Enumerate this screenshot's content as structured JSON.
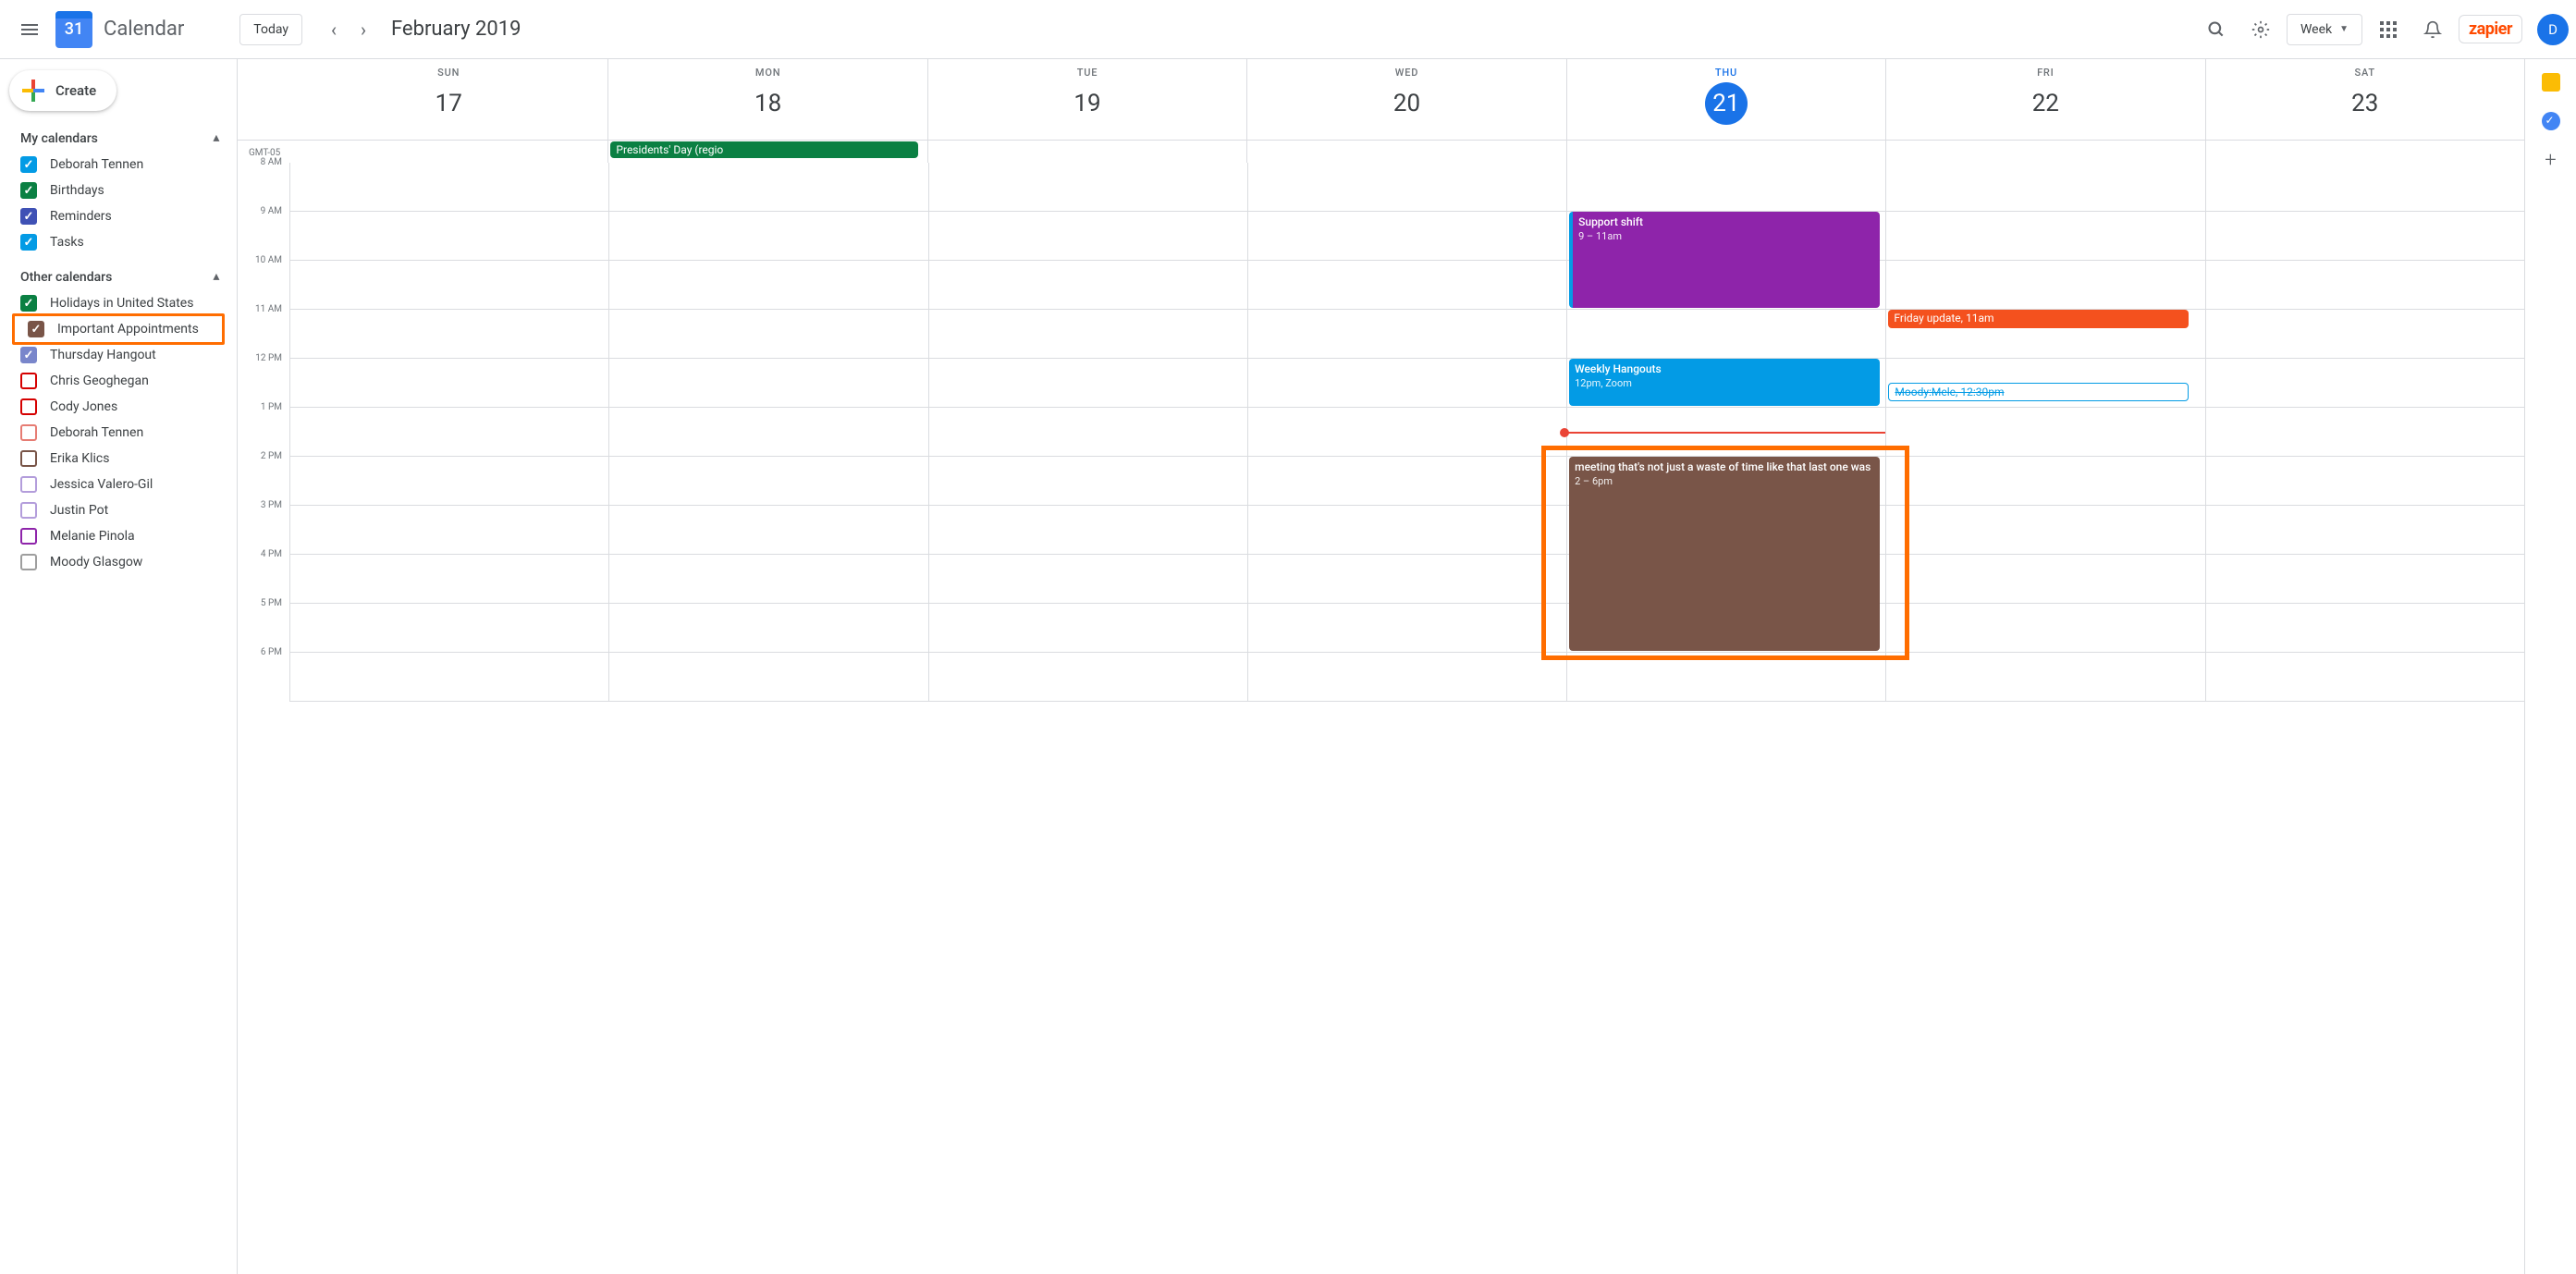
{
  "header": {
    "logo_day": "31",
    "app_name": "Calendar",
    "today_label": "Today",
    "month_title": "February 2019",
    "view_label": "Week",
    "avatar_letter": "D",
    "zapier_label": "zapier"
  },
  "sidebar": {
    "create_label": "Create",
    "my_calendars_title": "My calendars",
    "my_calendars": [
      {
        "label": "Deborah Tennen",
        "color": "#039be5",
        "checked": true
      },
      {
        "label": "Birthdays",
        "color": "#0b8043",
        "checked": true
      },
      {
        "label": "Reminders",
        "color": "#3f51b5",
        "checked": true
      },
      {
        "label": "Tasks",
        "color": "#039be5",
        "checked": true
      }
    ],
    "other_calendars_title": "Other calendars",
    "other_calendars": [
      {
        "label": "Holidays in United States",
        "color": "#0b8043",
        "checked": true,
        "highlighted": false
      },
      {
        "label": "Important Appointments",
        "color": "#795548",
        "checked": true,
        "highlighted": true
      },
      {
        "label": "Thursday Hangout",
        "color": "#7986cb",
        "checked": true,
        "highlighted": false
      },
      {
        "label": "Chris Geoghegan",
        "color": "#d50000",
        "checked": false,
        "highlighted": false
      },
      {
        "label": "Cody Jones",
        "color": "#d50000",
        "checked": false,
        "highlighted": false
      },
      {
        "label": "Deborah Tennen",
        "color": "#e67c73",
        "checked": false,
        "highlighted": false
      },
      {
        "label": "Erika Klics",
        "color": "#795548",
        "checked": false,
        "highlighted": false
      },
      {
        "label": "Jessica Valero-Gil",
        "color": "#b39ddb",
        "checked": false,
        "highlighted": false
      },
      {
        "label": "Justin Pot",
        "color": "#b39ddb",
        "checked": false,
        "highlighted": false
      },
      {
        "label": "Melanie Pinola",
        "color": "#8e24aa",
        "checked": false,
        "highlighted": false
      },
      {
        "label": "Moody Glasgow",
        "color": "#9e9e9e",
        "checked": false,
        "highlighted": false
      }
    ]
  },
  "calendar": {
    "timezone": "GMT-05",
    "days": [
      {
        "abbr": "SUN",
        "num": "17",
        "today": false
      },
      {
        "abbr": "MON",
        "num": "18",
        "today": false
      },
      {
        "abbr": "TUE",
        "num": "19",
        "today": false
      },
      {
        "abbr": "WED",
        "num": "20",
        "today": false
      },
      {
        "abbr": "THU",
        "num": "21",
        "today": true
      },
      {
        "abbr": "FRI",
        "num": "22",
        "today": false
      },
      {
        "abbr": "SAT",
        "num": "23",
        "today": false
      }
    ],
    "hours": [
      "8 AM",
      "9 AM",
      "10 AM",
      "11 AM",
      "12 PM",
      "1 PM",
      "2 PM",
      "3 PM",
      "4 PM",
      "5 PM",
      "6 PM"
    ],
    "allday_events": {
      "mon": {
        "title": "Presidents' Day (regio"
      }
    },
    "events": {
      "thu_support": {
        "title": "Support shift",
        "time": "9 – 11am"
      },
      "thu_hangouts": {
        "title": "Weekly Hangouts",
        "time": "12pm, Zoom"
      },
      "thu_meeting": {
        "title": "meeting that's not just a waste of time like that last one was",
        "time": "2 – 6pm"
      },
      "fri_update": {
        "title": "Friday update,",
        "time": "11am"
      },
      "fri_moody": {
        "title": "Moody:Mele, 12:30pm"
      }
    }
  }
}
